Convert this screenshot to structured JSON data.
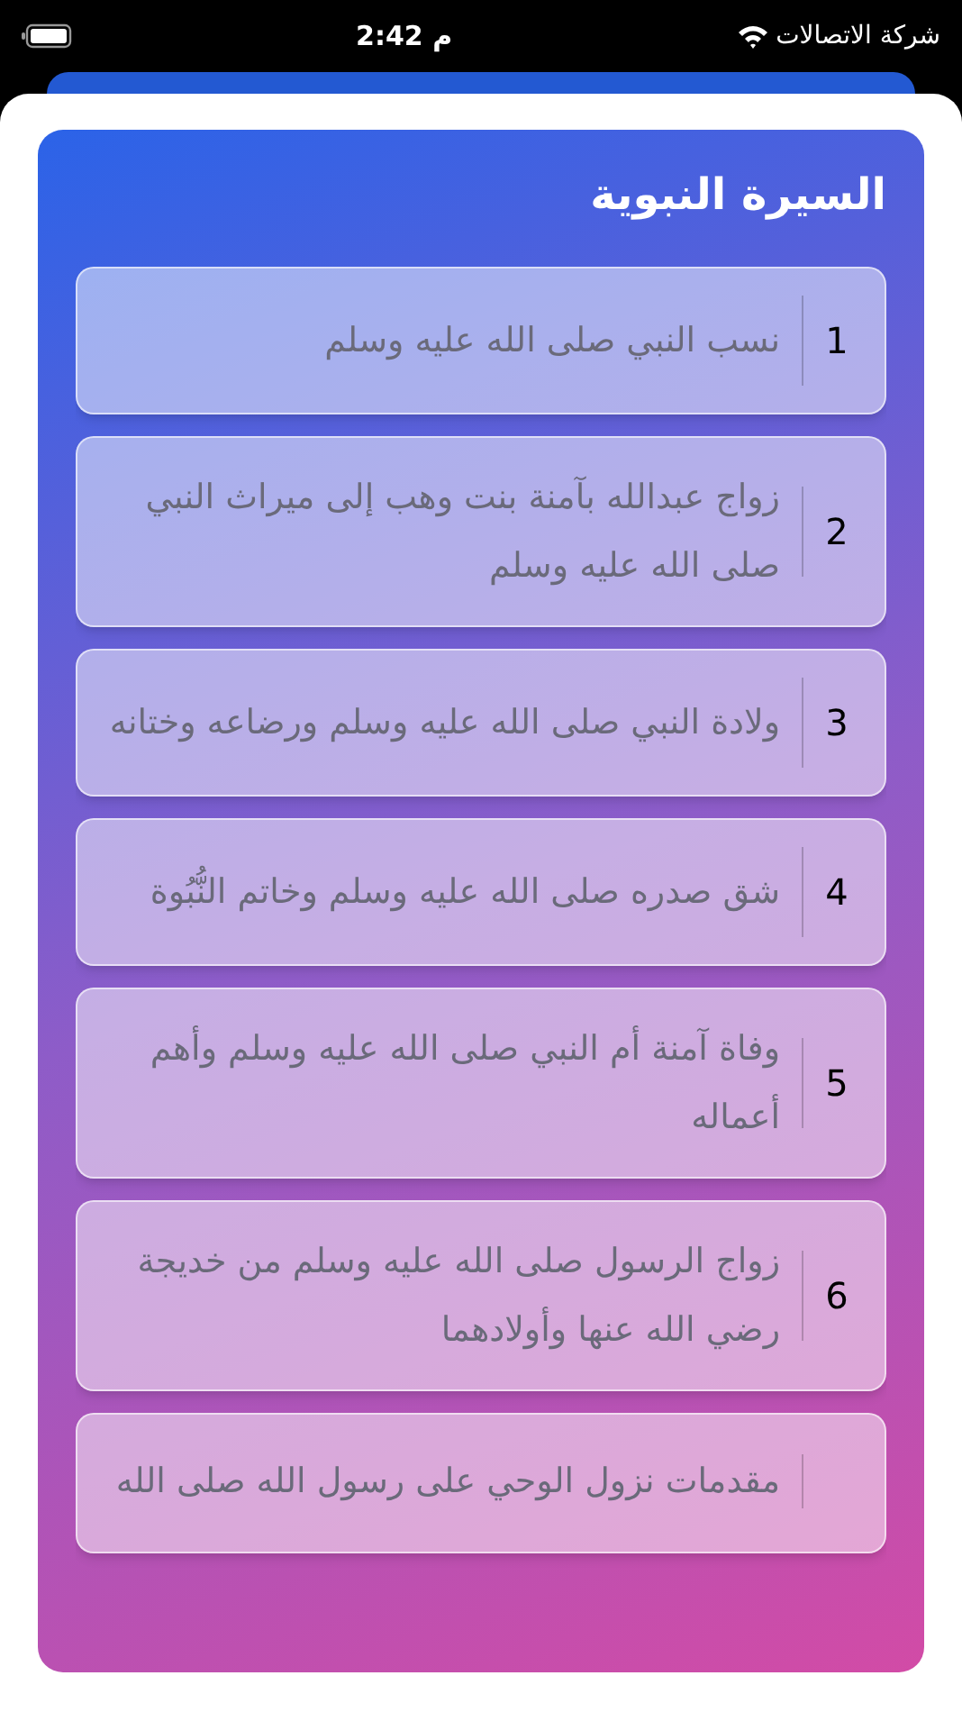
{
  "status_bar": {
    "carrier": "شركة الاتصالات",
    "time": "2:42 م"
  },
  "title": "السيرة النبوية",
  "items": [
    {
      "number": "1",
      "text": "نسب النبي صلى الله عليه وسلم"
    },
    {
      "number": "2",
      "text": "زواج عبدالله بآمنة بنت وهب إلى ميراث النبي صلى الله عليه وسلم"
    },
    {
      "number": "3",
      "text": "ولادة النبي صلى الله عليه وسلم ورضاعه وختانه"
    },
    {
      "number": "4",
      "text": "شق صدره صلى الله عليه وسلم وخاتم النُّبُوة"
    },
    {
      "number": "5",
      "text": "وفاة آمنة أم النبي صلى الله عليه وسلم وأهم أعماله"
    },
    {
      "number": "6",
      "text": "زواج الرسول صلى الله عليه وسلم من خديجة رضي الله عنها وأولادهما"
    },
    {
      "text": "مقدمات نزول الوحي على رسول الله صلى الله"
    }
  ]
}
